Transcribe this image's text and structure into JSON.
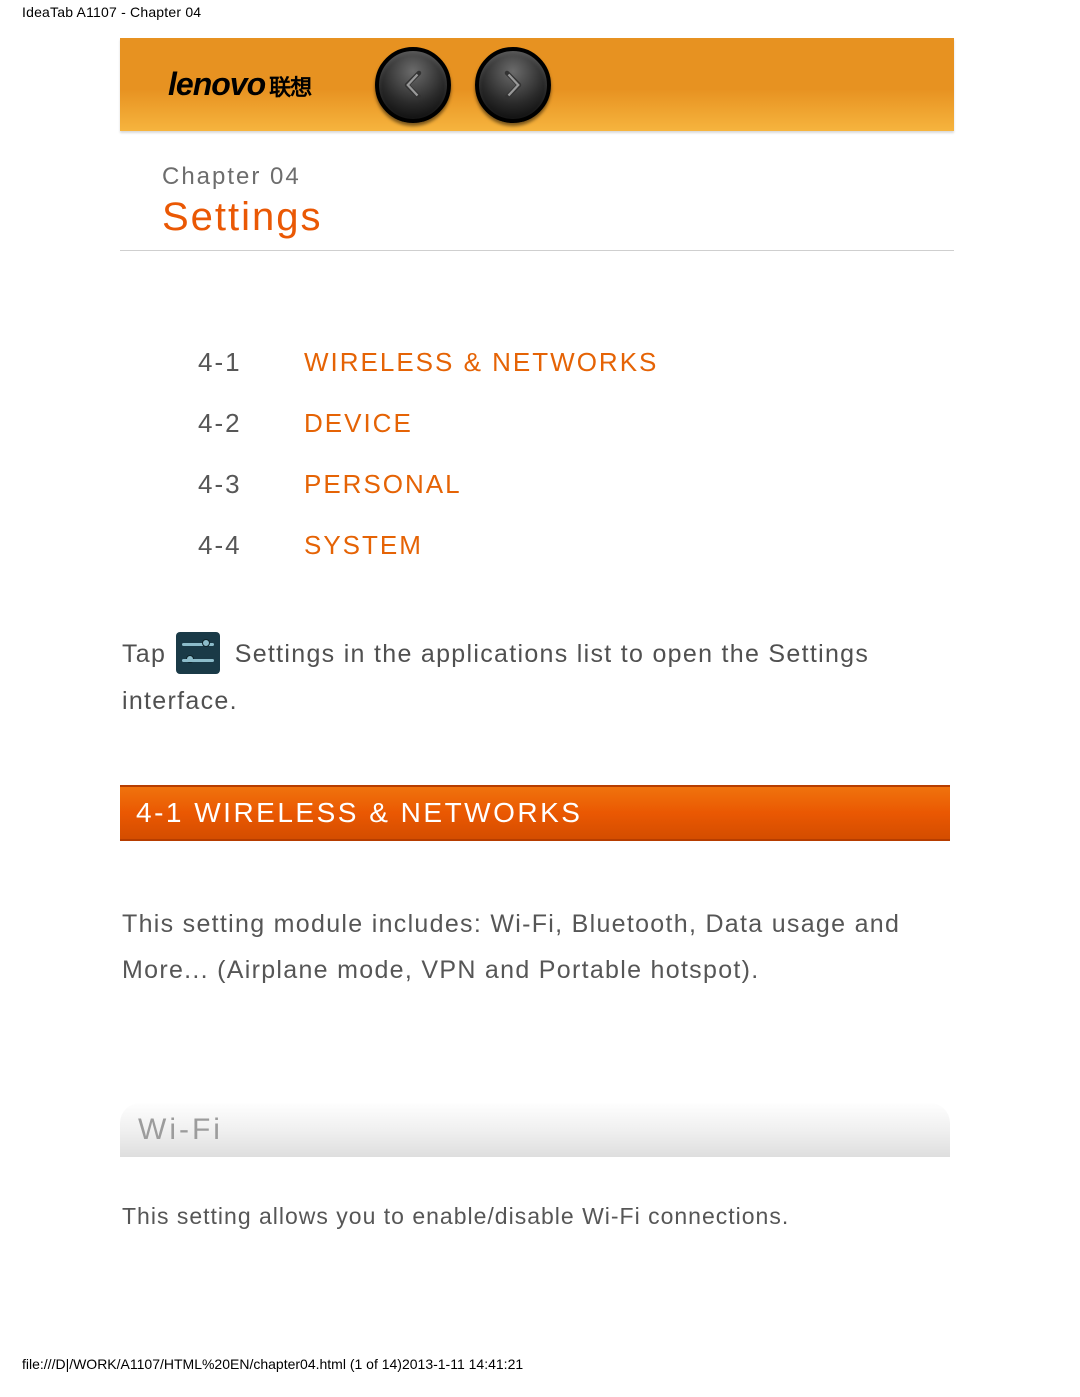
{
  "page": {
    "header_text": "IdeaTab A1107 - Chapter 04",
    "footer_text": "file:///D|/WORK/A1107/HTML%20EN/chapter04.html (1 of 14)2013-1-11 14:41:21"
  },
  "banner": {
    "logo_text": "lenovo",
    "logo_cn": "联想",
    "prev_label": "Previous chapter",
    "next_label": "Next chapter"
  },
  "chapter": {
    "label": "Chapter 04",
    "title": "Settings"
  },
  "toc": [
    {
      "num": "4-1",
      "label": "WIRELESS & NETWORKS"
    },
    {
      "num": "4-2",
      "label": "DEVICE"
    },
    {
      "num": "4-3",
      "label": "PERSONAL"
    },
    {
      "num": "4-4",
      "label": "SYSTEM"
    }
  ],
  "intro": {
    "before_icon": "Tap ",
    "icon_name": "settings-icon",
    "after_icon": " Settings in the applications list to open the Settings interface."
  },
  "section_41": {
    "heading": "4-1 WIRELESS & NETWORKS",
    "body": "This setting module includes: Wi-Fi, Bluetooth, Data usage and More... (Airplane mode, VPN and Portable hotspot)."
  },
  "wifi": {
    "heading": "Wi-Fi",
    "body": "This setting allows you to enable/disable Wi-Fi connections."
  }
}
